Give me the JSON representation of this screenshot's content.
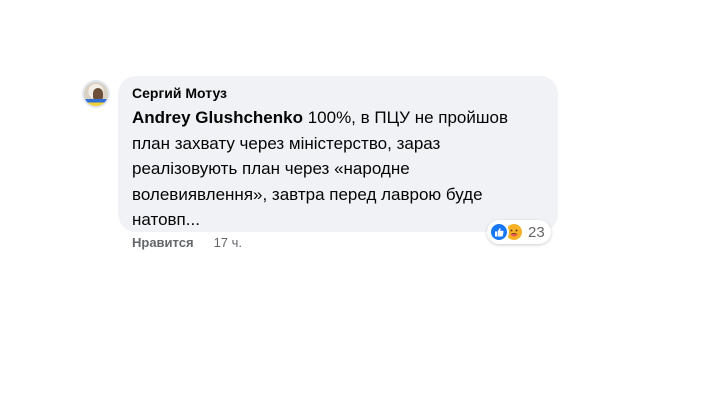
{
  "comment": {
    "author": "Сергий Мотуз",
    "mention": "Andrey Glushchenko",
    "text": " 100%, в ПЦУ не пройшов план захвату через міністерство, зараз реалізовують план через «народне волевиявлення», завтра перед лаврою буде натовп...",
    "reactions": {
      "icons": [
        "like-icon",
        "care-icon"
      ],
      "count": "23"
    },
    "actions": {
      "like_label": "Нравится",
      "time": "17 ч."
    }
  },
  "colors": {
    "bubble": "#f0f2f5",
    "like": "#1877f2",
    "care": "#f7b125",
    "secondary_text": "#65676b"
  }
}
